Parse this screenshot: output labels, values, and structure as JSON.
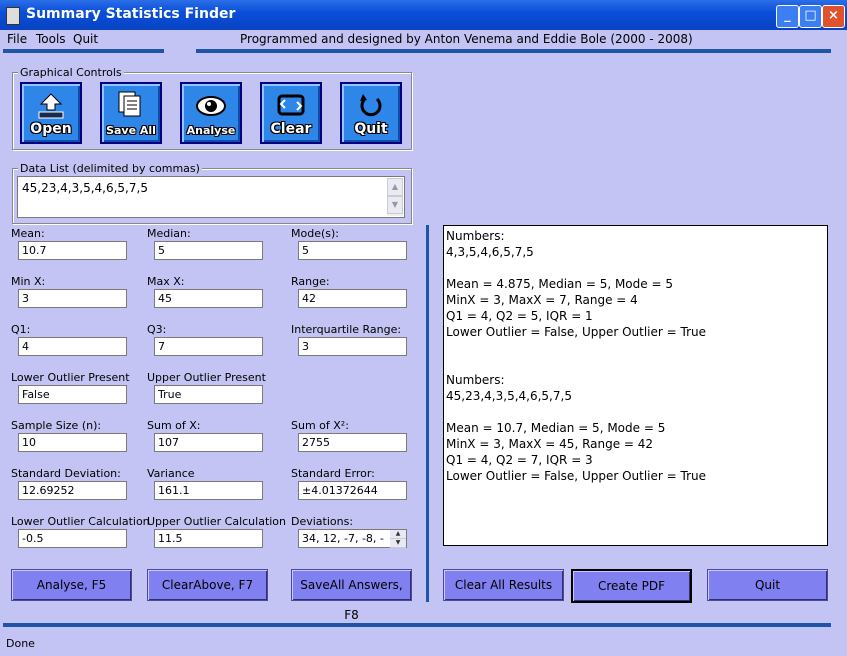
{
  "window": {
    "title": "Summary Statistics Finder"
  },
  "menu": {
    "items": [
      "File",
      "Tools",
      "Quit"
    ],
    "credit": "Programmed and designed  by Anton Venema and Eddie Bole (2000 - 2008)"
  },
  "graphical_controls": {
    "label": "Graphical Controls",
    "buttons": [
      {
        "label": "Open",
        "icon": "open-icon"
      },
      {
        "label": "Save All",
        "icon": "save-all-icon"
      },
      {
        "label": "Analyse",
        "icon": "eye-icon"
      },
      {
        "label": "Clear",
        "icon": "clear-icon"
      },
      {
        "label": "Quit",
        "icon": "power-icon"
      }
    ]
  },
  "data_list": {
    "label": "Data List (delimited by commas)",
    "value": "45,23,4,3,5,4,6,5,7,5"
  },
  "stats": {
    "mean": {
      "label": "Mean:",
      "value": "10.7"
    },
    "median": {
      "label": "Median:",
      "value": "5"
    },
    "modes": {
      "label": "Mode(s):",
      "value": "5"
    },
    "min_x": {
      "label": "Min X:",
      "value": "3"
    },
    "max_x": {
      "label": "Max X:",
      "value": "45"
    },
    "range": {
      "label": "Range:",
      "value": "42"
    },
    "q1": {
      "label": "Q1:",
      "value": "4"
    },
    "q3": {
      "label": "Q3:",
      "value": "7"
    },
    "iqr": {
      "label": "Interquartile Range:",
      "value": "3"
    },
    "lower_outlier": {
      "label": "Lower Outlier Present",
      "value": "False"
    },
    "upper_outlier": {
      "label": "Upper Outlier Present",
      "value": "True"
    },
    "sample_size": {
      "label": "Sample Size (n):",
      "value": "10"
    },
    "sum_x": {
      "label": "Sum of X:",
      "value": "107"
    },
    "sum_x2": {
      "label": "Sum of X²:",
      "value": "2755"
    },
    "std_dev": {
      "label": "Standard Deviation:",
      "value": "12.69252"
    },
    "variance": {
      "label": "Variance",
      "value": "161.1"
    },
    "std_error": {
      "label": "Standard Error:",
      "value": "±4.01372644"
    },
    "lower_calc": {
      "label": "Lower Outlier Calculation",
      "value": "-0.5"
    },
    "upper_calc": {
      "label": "Upper Outlier Calculation",
      "value": "11.5"
    },
    "deviations": {
      "label": "Deviations:",
      "value": "34, 12, -7, -8, -"
    }
  },
  "buttons": {
    "analyse": "Analyse, F5",
    "clear_above": "ClearAbove, F7",
    "save_all_answers": "SaveAll Answers, F8",
    "clear_all_results": "Clear All Results",
    "create_pdf": "Create PDF",
    "quit": "Quit"
  },
  "results": {
    "lines": [
      "Numbers:",
      "4,3,5,4,6,5,7,5",
      "",
      "Mean = 4.875,  Median = 5,  Mode = 5",
      "MinX = 3,  MaxX = 7,  Range = 4",
      "Q1 = 4,  Q2 = 5,  IQR = 1",
      "Lower Outlier = False,  Upper Outlier = True",
      "",
      "",
      "Numbers:",
      "45,23,4,3,5,4,6,5,7,5",
      "",
      "Mean = 10.7,  Median = 5,  Mode = 5",
      "MinX = 3,  MaxX = 45,  Range = 42",
      "Q1 = 4,  Q2 = 7,  IQR = 3",
      "Lower Outlier = False,  Upper Outlier = True"
    ]
  },
  "status": {
    "text": "Done"
  }
}
